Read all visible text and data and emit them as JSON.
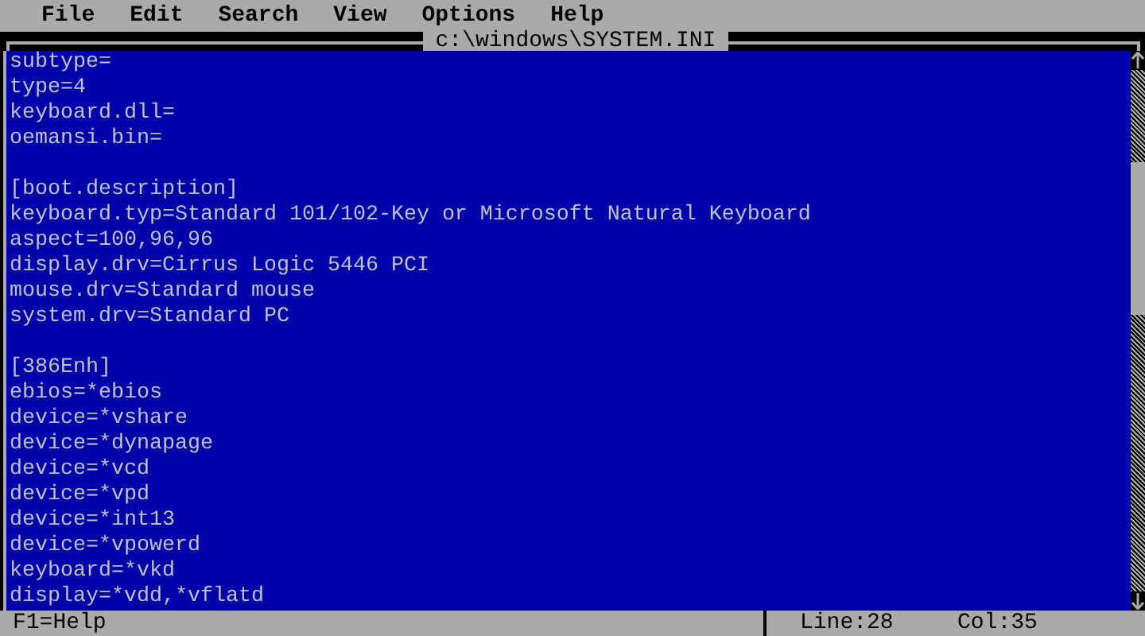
{
  "menu": [
    "File",
    "Edit",
    "Search",
    "View",
    "Options",
    "Help"
  ],
  "window": {
    "title": "c:\\windows\\SYSTEM.INI"
  },
  "sections": [
    {
      "lines": [
        "subtype=",
        "type=4",
        "keyboard.dll=",
        "oemansi.bin="
      ]
    },
    {
      "lines": [
        "[boot.description]",
        "keyboard.typ=Standard 101/102-Key or Microsoft Natural Keyboard",
        "aspect=100,96,96",
        "display.drv=Cirrus Logic 5446 PCI",
        "mouse.drv=Standard mouse",
        "system.drv=Standard PC"
      ]
    },
    {
      "lines": [
        "[386Enh]",
        "ebios=*ebios",
        "device=*vshare",
        "device=*dynapage",
        "device=*vcd",
        "device=*vpd",
        "device=*int13",
        "device=*vpowerd",
        "keyboard=*vkd",
        "display=*vdd,*vflatd"
      ]
    }
  ],
  "status_bar": {
    "help": "F1=Help",
    "line": "Line:28",
    "col": "Col:35"
  }
}
